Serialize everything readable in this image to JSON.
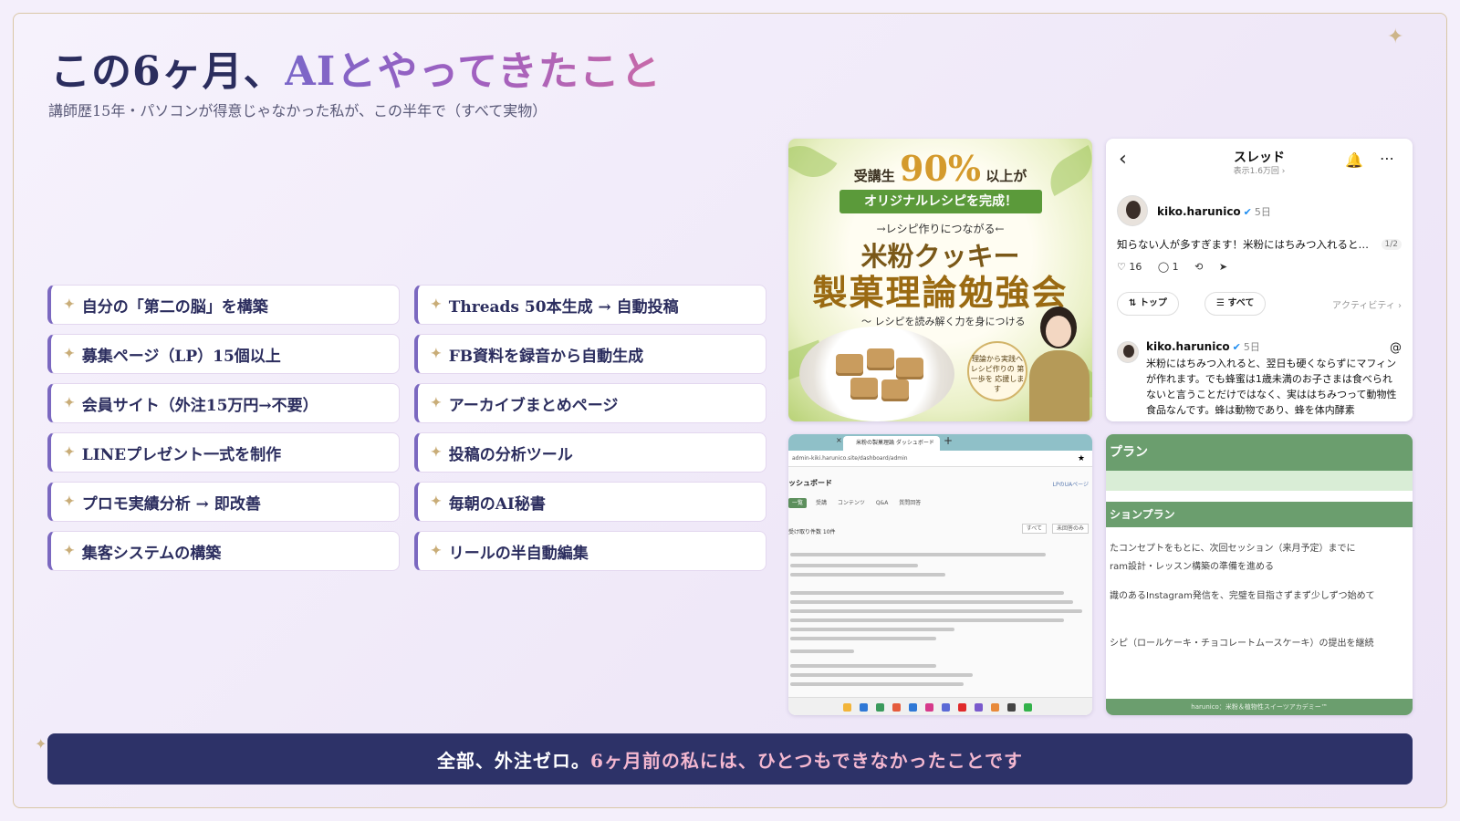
{
  "header": {
    "title_prefix": "この6ヶ月、",
    "title_highlight": "AIとやってきたこと",
    "subtitle": "講師歴15年・パソコンが得意じゃなかった私が、この半年で（すべて実物）"
  },
  "achievements": {
    "bullet": "✦",
    "items": [
      "自分の「第二の脳」を構築",
      "Threads 50本生成 → 自動投稿",
      "募集ページ（LP）15個以上",
      "FB資料を録音から自動生成",
      "会員サイト（外注15万円→不要）",
      "アーカイブまとめページ",
      "LINEプレゼント一式を制作",
      "投稿の分析ツール",
      "プロモ実績分析 → 即改善",
      "毎朝のAI秘書",
      "集客システムの構築",
      "リールの半自動編集"
    ]
  },
  "poster": {
    "line1_before": "受講生",
    "line1_big": "90%",
    "line1_after": "以上が",
    "ribbon": "オリジナルレシピを完成！",
    "line2": "→レシピ作りにつながる←",
    "line3": "米粉クッキー",
    "line4": "製菓理論勉強会",
    "line5": "〜 レシピを読み解く力を身につける",
    "badge": "理論から実践へ レシピ作りの 第一歩を 応援します"
  },
  "threads": {
    "back_icon": "‹",
    "title": "スレッド",
    "views": "表示1.6万回 ›",
    "bell_icon": "🔔",
    "more_icon": "⋯",
    "username": "kiko.harunico",
    "verified_icon": "✔",
    "age": "5日",
    "post1": "知らない人が多すぎます！米粉にはちみつ入れると…",
    "page": "1/2",
    "likes": "♡ 16",
    "replies": "◯ 1",
    "repost_icon": "⟲",
    "share_icon": "➤",
    "pill_top": "⇅ トップ",
    "pill_all": "☰ すべて",
    "activity": "アクティビティ ›",
    "threads_icon": "@",
    "post2": "米粉にはちみつ入れると、翌日も硬くならずにマフィンが作れます。でも蜂蜜は1歳未満のお子さまは食べられないと言うことだけではなく、実ははちみつって動物性食品なんです。蜂は動物であり、蜂を体内酵素"
  },
  "dashboard": {
    "tab_close": "×",
    "tab_title": "米粉の製菓理論 ダッシュボード",
    "new_tab": "+",
    "url": "admin-kiki.harunico.site/dashboard/admin",
    "star_icon": "★",
    "title": "ッシュボード",
    "lp_link": "LPのUAページ",
    "nav_active": "一覧",
    "nav_items": [
      "受講",
      "コンテンツ",
      "Q&A",
      "質問回答"
    ],
    "row_text": "受け取り件数 10件",
    "btn1": "すべて",
    "btn2": "未回答のみ"
  },
  "plan": {
    "heading1": "プラン",
    "heading2": "ションプラン",
    "lines": [
      "たコンセプトをもとに、次回セッション（来月予定）までに",
      "ram設計・レッスン構築の準備を進める",
      "識のあるInstagram発信を、完璧を目指さずまず少しずつ始めて",
      "シピ（ロールケーキ・チョコレートムースケーキ）の提出を継続"
    ],
    "footer": "harunico：米粉＆植物性スイーツアカデミー™"
  },
  "banner": {
    "part1": "全部、外注ゼロ。",
    "part2": "6ヶ月前の私には、ひとつもできなかったことです"
  },
  "decor": {
    "sparkle_icon": "✦"
  }
}
